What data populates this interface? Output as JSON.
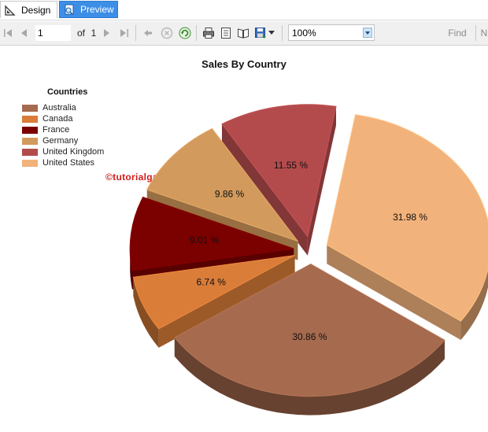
{
  "tabs": {
    "design": "Design",
    "preview": "Preview"
  },
  "toolbar": {
    "page_current": "1",
    "page_of": "of",
    "page_total": "1",
    "zoom": "100%",
    "find": "Find",
    "next_partial": "N"
  },
  "icons": [
    "design-icon",
    "preview-icon",
    "first-page-icon",
    "prev-page-icon",
    "next-page-icon",
    "last-page-icon",
    "back-icon",
    "stop-icon",
    "refresh-icon",
    "print-icon",
    "print-layout-icon",
    "page-setup-icon",
    "export-icon",
    "dropdown-icon"
  ],
  "watermark": "©tutorialgateway.org",
  "chart_data": {
    "type": "pie",
    "title": "Sales By Country",
    "legend_title": "Countries",
    "legend_position": "top-left",
    "exploded": true,
    "style": "3d",
    "categories": [
      "Australia",
      "Canada",
      "France",
      "Germany",
      "United Kingdom",
      "United States"
    ],
    "values": [
      30.86,
      6.74,
      9.01,
      9.86,
      11.55,
      31.98
    ],
    "labels": [
      "30.86 %",
      "6.74 %",
      "9.01 %",
      "9.86 %",
      "11.55 %",
      "31.98 %"
    ],
    "colors": [
      "#a66a4e",
      "#d97d39",
      "#7b0000",
      "#d29a5c",
      "#b34b4d",
      "#f2b27b"
    ]
  }
}
